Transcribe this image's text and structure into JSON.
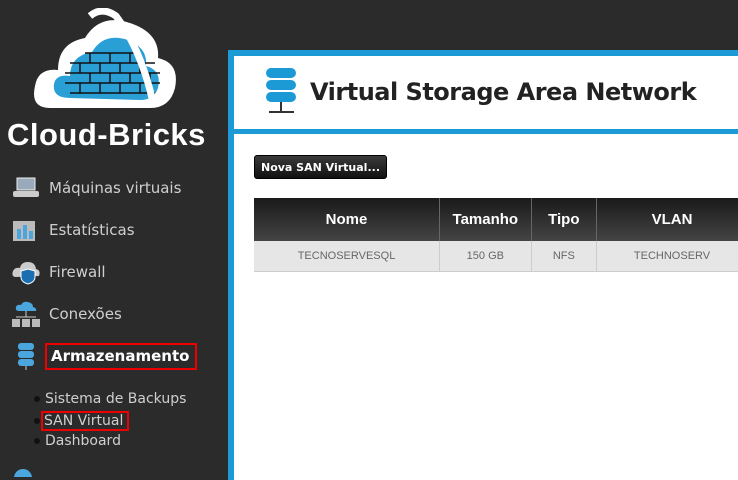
{
  "brand": {
    "name": "Cloud-Bricks"
  },
  "sidebar": {
    "items": [
      {
        "label": "Máquinas virtuais",
        "icon": "vm-icon"
      },
      {
        "label": "Estatísticas",
        "icon": "stats-icon"
      },
      {
        "label": "Firewall",
        "icon": "firewall-icon"
      },
      {
        "label": "Conexões",
        "icon": "connections-icon"
      },
      {
        "label": "Armazenamento",
        "icon": "storage-icon",
        "active": true
      }
    ],
    "subitems": [
      {
        "label": "Sistema de Backups"
      },
      {
        "label": "SAN Virtual",
        "active": true
      },
      {
        "label": "Dashboard"
      }
    ]
  },
  "page": {
    "title": "Virtual Storage Area Network",
    "new_button": "Nova SAN Virtual..."
  },
  "table": {
    "headers": [
      "Nome",
      "Tamanho",
      "Tipo",
      "VLAN"
    ],
    "rows": [
      [
        "TECNOSERVESQL",
        "150 GB",
        "NFS",
        "TECHNOSERV"
      ]
    ]
  },
  "colors": {
    "accent": "#1b9ad6",
    "sidebar": "#2b2b2b",
    "highlight": "#ee0000"
  }
}
